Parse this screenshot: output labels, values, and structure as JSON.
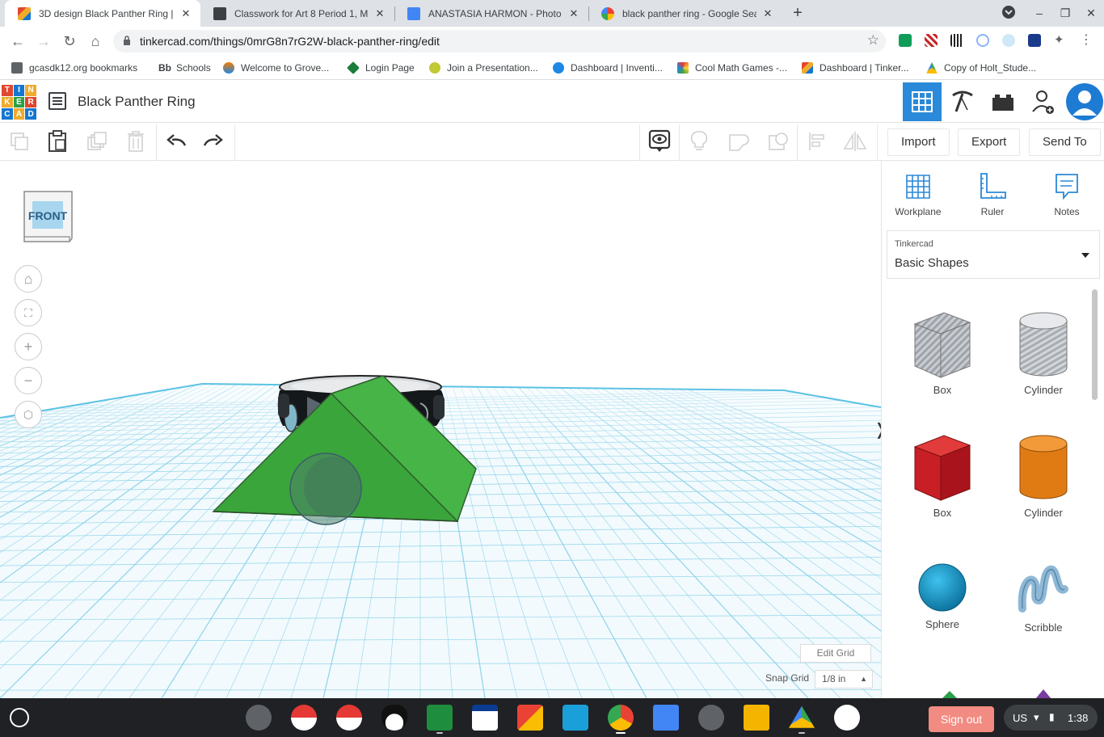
{
  "browser": {
    "tabs": [
      {
        "title": "3D design Black Panther Ring | T",
        "active": true,
        "favicon_color": "#1477d1"
      },
      {
        "title": "Classwork for Art 8 Period 1, MP",
        "active": false,
        "favicon_color": "#3c4043"
      },
      {
        "title": "ANASTASIA HARMON - Photo Do",
        "active": false,
        "favicon_color": "#4285f4"
      },
      {
        "title": "black panther ring - Google Sear",
        "active": false,
        "favicon_color": "#4285f4"
      }
    ],
    "new_tab_label": "+",
    "url": "tinkercad.com/things/0mrG8n7rG2W-black-panther-ring/edit",
    "bookmarks": [
      "gcasdk12.org bookmarks",
      "Schools",
      "Welcome to Grove...",
      "Login Page",
      "Join a Presentation...",
      "Dashboard | Inventi...",
      "Cool Math Games -...",
      "Dashboard | Tinker...",
      "Copy of Holt_Stude..."
    ],
    "bookmark_bb": "Bb"
  },
  "tinkercad": {
    "logo_letters": [
      "T",
      "I",
      "N",
      "K",
      "E",
      "R",
      "C",
      "A",
      "D"
    ],
    "design_title": "Black Panther Ring",
    "toolbar": {
      "import_label": "Import",
      "export_label": "Export",
      "sendto_label": "Send To"
    },
    "viewcube_label": "FRONT",
    "edit_grid_label": "Edit Grid",
    "snap_grid_label": "Snap Grid",
    "snap_grid_value": "1/8 in",
    "panel_tools": [
      "Workplane",
      "Ruler",
      "Notes"
    ],
    "library_source": "Tinkercad",
    "library_name": "Basic Shapes",
    "shapes": [
      {
        "label": "Box",
        "style": "hole"
      },
      {
        "label": "Cylinder",
        "style": "hole"
      },
      {
        "label": "Box",
        "style": "solid"
      },
      {
        "label": "Cylinder",
        "style": "solid"
      },
      {
        "label": "Sphere",
        "style": "solid"
      },
      {
        "label": "Scribble",
        "style": "solid"
      }
    ],
    "colors": {
      "accent": "#2a89d8",
      "roof_green": "#3faa3f",
      "grid_line": "#8fd3ea"
    }
  },
  "shelf": {
    "signout_label": "Sign out",
    "locale": "US",
    "time": "1:38"
  }
}
